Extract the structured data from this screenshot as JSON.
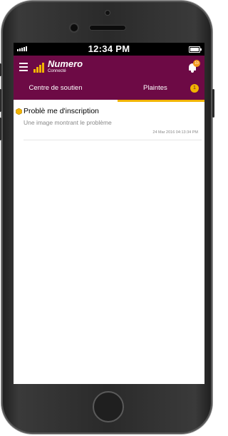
{
  "status_bar": {
    "time": "12:34 PM"
  },
  "app_bar": {
    "logo_text": "Numero",
    "logo_status": "Connecté",
    "bell_count": "10"
  },
  "tabs": [
    {
      "label": "Centre de soutien",
      "active": false
    },
    {
      "label": "Plaintes",
      "active": true,
      "badge": "1"
    }
  ],
  "complaints": [
    {
      "title": "Problè me d'inscription",
      "description": "Une image montrant le problème",
      "timestamp": "24 Mar 2016 04:13:34 PM"
    }
  ],
  "colors": {
    "brand": "#6d0a45",
    "accent": "#f2b400",
    "badge": "#f39a1e"
  }
}
